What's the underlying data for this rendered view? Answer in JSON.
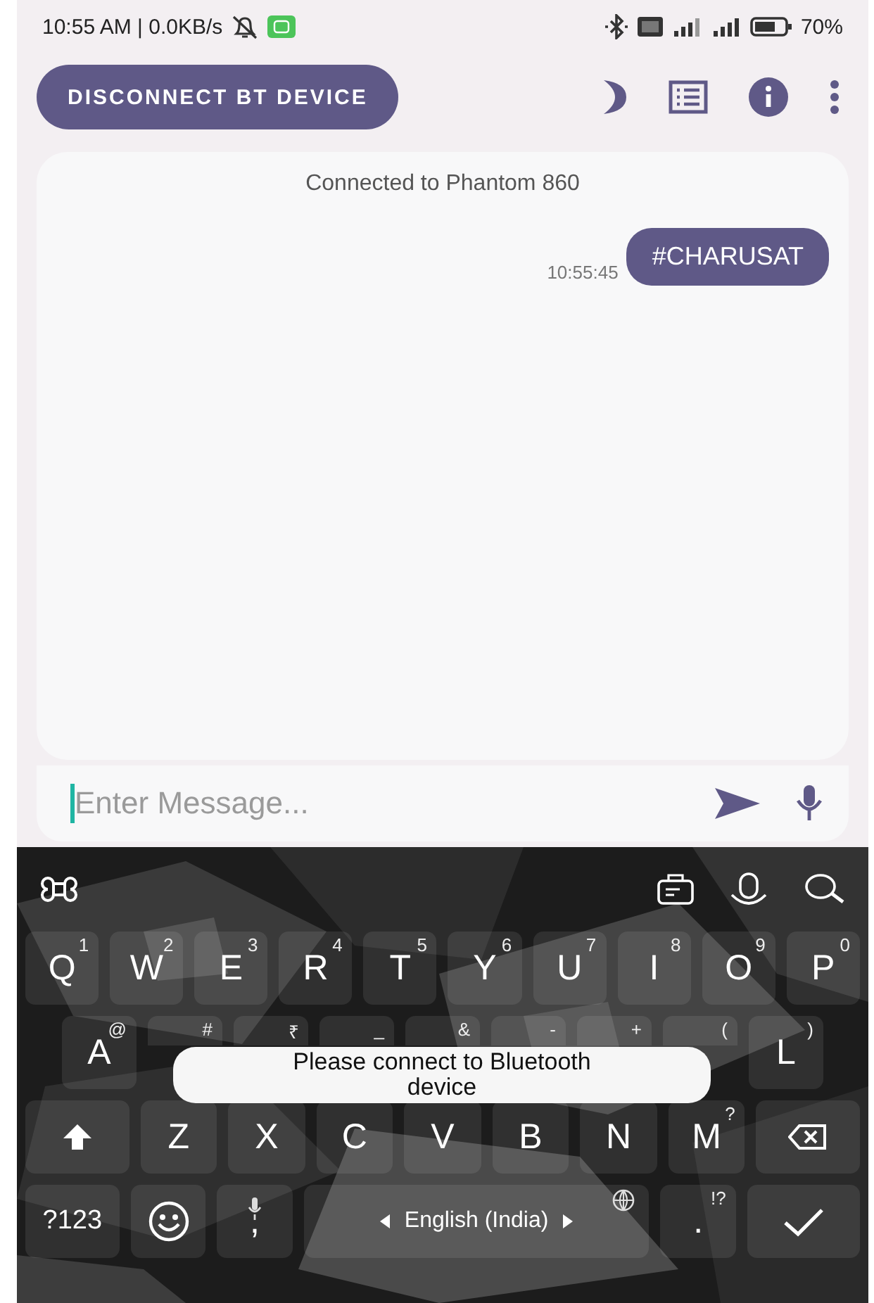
{
  "status_bar": {
    "time": "10:55 AM | 0.0KB/s",
    "battery": "70%"
  },
  "toolbar": {
    "button": "DISCONNECT BT DEVICE"
  },
  "chat": {
    "status": "Connected to Phantom 860",
    "messages": [
      {
        "text": "#CHARUSAT",
        "time": "10:55:45",
        "kind": "outgoing"
      }
    ]
  },
  "composer": {
    "placeholder": "Enter Message...",
    "focused": true
  },
  "keyboard": {
    "rows": [
      {
        "keys": [
          {
            "kind": "letter",
            "label": "Q",
            "hint": "1"
          },
          {
            "kind": "letter",
            "label": "W",
            "hint": "2"
          },
          {
            "kind": "letter",
            "label": "E",
            "hint": "3"
          },
          {
            "kind": "letter",
            "label": "R",
            "hint": "4"
          },
          {
            "kind": "letter",
            "label": "T",
            "hint": "5"
          },
          {
            "kind": "letter",
            "label": "Y",
            "hint": "6"
          },
          {
            "kind": "letter",
            "label": "U",
            "hint": "7"
          },
          {
            "kind": "letter",
            "label": "I",
            "hint": "8"
          },
          {
            "kind": "letter",
            "label": "O",
            "hint": "9"
          },
          {
            "kind": "letter",
            "label": "P",
            "hint": "0"
          }
        ]
      },
      {
        "keys": [
          {
            "kind": "letter",
            "label": "A",
            "hint": "@"
          },
          {
            "kind": "letter",
            "hint": "#"
          },
          {
            "kind": "letter",
            "hint": "₹"
          },
          {
            "kind": "letter",
            "hint": "_"
          },
          {
            "kind": "letter",
            "hint": "&"
          },
          {
            "kind": "letter",
            "hint": "-"
          },
          {
            "kind": "letter",
            "hint": "+"
          },
          {
            "kind": "letter",
            "hint": "("
          },
          {
            "kind": "letter",
            "label": "L",
            "hint": ")"
          }
        ]
      },
      {
        "keys": [
          {
            "kind": "shift"
          },
          {
            "kind": "letter",
            "label": "Z"
          },
          {
            "kind": "letter",
            "label": "X"
          },
          {
            "kind": "letter",
            "label": "C"
          },
          {
            "kind": "letter",
            "label": "V"
          },
          {
            "kind": "letter",
            "label": "B"
          },
          {
            "kind": "letter",
            "label": "N"
          },
          {
            "kind": "letter",
            "label": "M",
            "hint": "?"
          },
          {
            "kind": "backspace"
          }
        ]
      },
      {
        "keys": [
          {
            "kind": "symbols",
            "label": "?123"
          },
          {
            "kind": "emoji"
          },
          {
            "kind": "comma",
            "label": ","
          },
          {
            "kind": "space",
            "label": "English (India)"
          },
          {
            "kind": "period",
            "label": ".",
            "hint": "!?"
          },
          {
            "kind": "enter"
          }
        ]
      }
    ]
  },
  "toast": {
    "text": "Please connect to Bluetooth device"
  }
}
